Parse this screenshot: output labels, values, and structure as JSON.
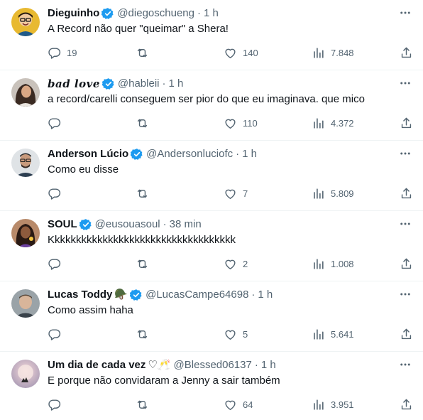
{
  "tweets": [
    {
      "name": "Dieguinho",
      "verified": true,
      "handle": "@diegoschueng",
      "time": "1 h",
      "text": "A Record não quer \"queimar\" a Shera!",
      "replies": "19",
      "retweets": "",
      "likes": "140",
      "views": "7.848"
    },
    {
      "name": "𝒃𝒂𝒅 𝒍𝒐𝒗𝒆",
      "verified": true,
      "handle": "@hableii",
      "time": "1 h",
      "text": "a record/carelli conseguem ser pior do que eu imaginava. que mico",
      "replies": "",
      "retweets": "",
      "likes": "110",
      "views": "4.372"
    },
    {
      "name": "Anderson Lúcio",
      "verified": true,
      "handle": "@Andersonluciofc",
      "time": "1 h",
      "text": "Como eu disse",
      "replies": "",
      "retweets": "",
      "likes": "7",
      "views": "5.809"
    },
    {
      "name": "SOUL",
      "verified": true,
      "handle": "@eusouasoul",
      "time": "38 min",
      "text": "Kkkkkkkkkkkkkkkkkkkkkkkkkkkkkkkkkkk",
      "replies": "",
      "retweets": "",
      "likes": "2",
      "views": "1.008"
    },
    {
      "name": "Lucas Toddy",
      "verified": true,
      "name_emoji": "🪖",
      "handle": "@LucasCampe64698",
      "time": "1 h",
      "text": "Como assim haha",
      "replies": "",
      "retweets": "",
      "likes": "5",
      "views": "5.641"
    },
    {
      "name": "Um dia de cada vez",
      "verified": false,
      "name_emoji": "♡🥂",
      "handle": "@Blessed06137",
      "time": "1 h",
      "text": "E porque não convidaram a Jenny a sair também",
      "replies": "",
      "retweets": "",
      "likes": "64",
      "views": "3.951"
    }
  ],
  "colors": {
    "text": "#0f1419",
    "secondary": "#536471",
    "verified": "#1d9bf0",
    "divider": "#eff3f4"
  },
  "icons": [
    "more-icon",
    "verified-badge-icon",
    "reply-icon",
    "retweet-icon",
    "like-icon",
    "views-icon",
    "share-icon"
  ],
  "separator": "·"
}
